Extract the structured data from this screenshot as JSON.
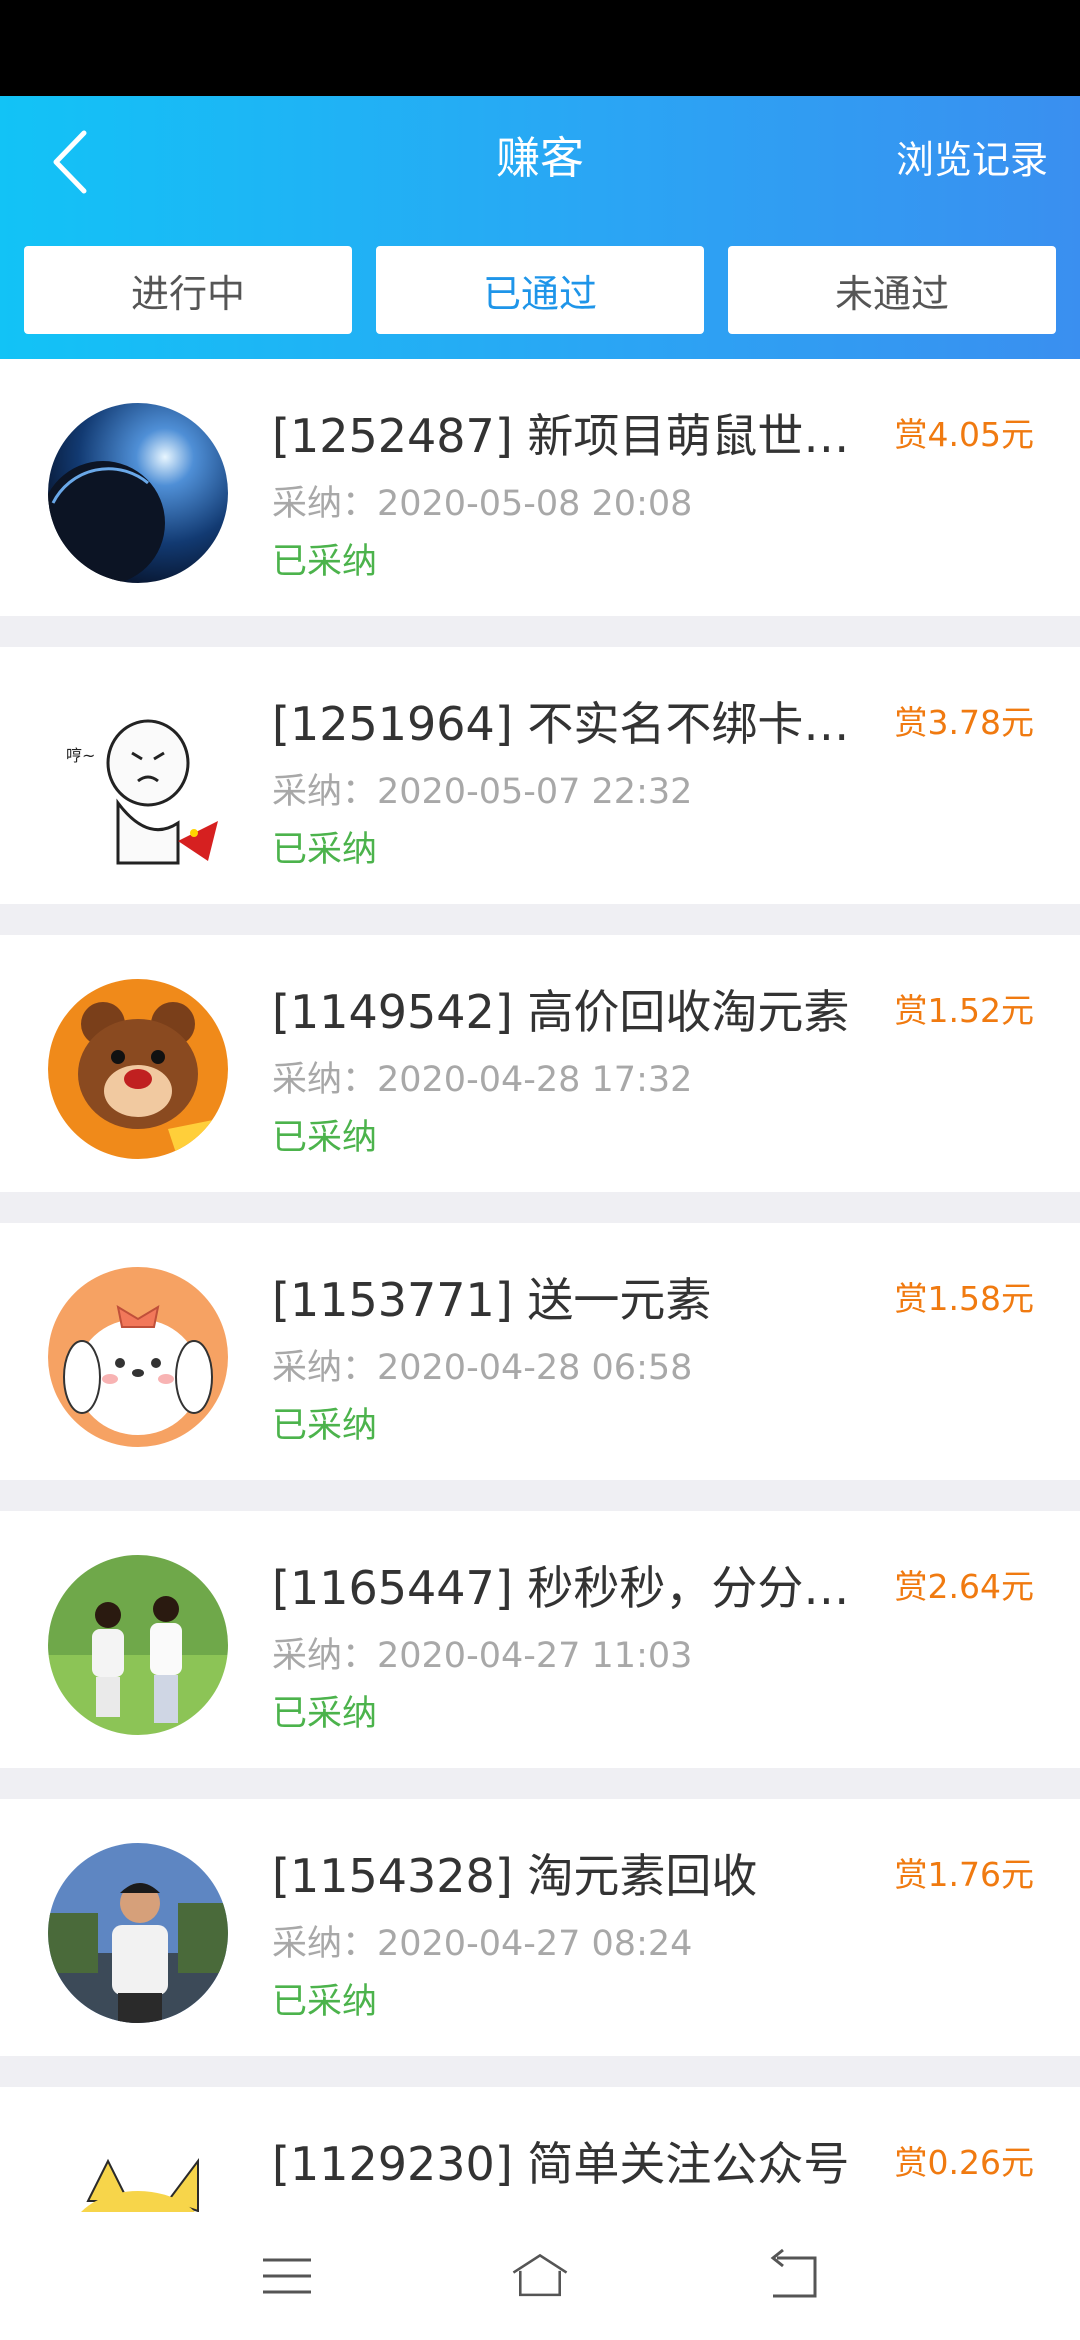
{
  "header": {
    "title": "赚客",
    "history_label": "浏览记录"
  },
  "tabs": [
    {
      "label": "进行中",
      "active": false
    },
    {
      "label": "已通过",
      "active": true
    },
    {
      "label": "未通过",
      "active": false
    }
  ],
  "items": [
    {
      "title": "[1252487] 新项目萌鼠世界…",
      "time": "采纳：2020-05-08 20:08",
      "status": "已采纳",
      "reward": "赏4.05元",
      "avatar": "planet-avatar"
    },
    {
      "title": "[1251964] 不实名不绑卡，…",
      "time": "采纳：2020-05-07 22:32",
      "status": "已采纳",
      "reward": "赏3.78元",
      "avatar": "cartoon-face-avatar"
    },
    {
      "title": "[1149542] 高价回收淘元素",
      "time": "采纳：2020-04-28 17:32",
      "status": "已采纳",
      "reward": "赏1.52元",
      "avatar": "bear-avatar"
    },
    {
      "title": "[1153771] 送一元素",
      "time": "采纳：2020-04-28 06:58",
      "status": "已采纳",
      "reward": "赏1.58元",
      "avatar": "puppy-avatar"
    },
    {
      "title": "[1165447] 秒秒秒，分分钟…",
      "time": "采纳：2020-04-27 11:03",
      "status": "已采纳",
      "reward": "赏2.64元",
      "avatar": "couple-avatar"
    },
    {
      "title": "[1154328] 淘元素回收",
      "time": "采纳：2020-04-27 08:24",
      "status": "已采纳",
      "reward": "赏1.76元",
      "avatar": "man-photo-avatar"
    },
    {
      "title": "[1129230] 简单关注公众号",
      "time": "",
      "status": "",
      "reward": "赏0.26元",
      "avatar": "pikachu-avatar"
    }
  ],
  "colors": {
    "header_gradient_start": "#12c3f6",
    "header_gradient_end": "#3a8ff0",
    "reward": "#f07a10",
    "status_accepted": "#4cb34c",
    "active_tab": "#1e95e9"
  }
}
